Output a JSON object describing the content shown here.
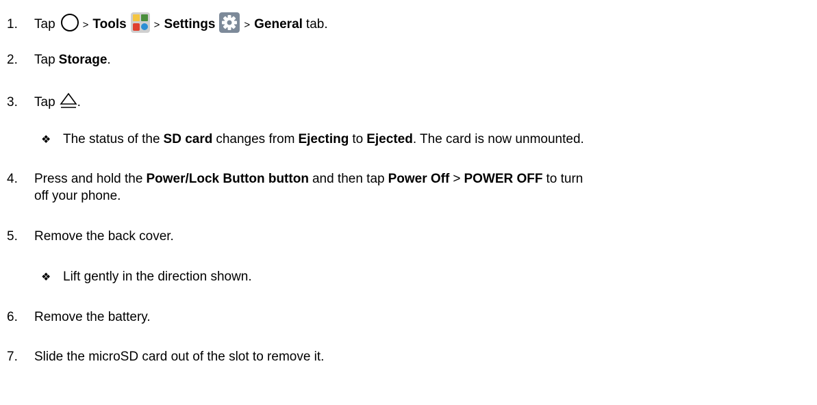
{
  "steps": {
    "s1": {
      "num": "1.",
      "t1": "Tap",
      "sep1": ">",
      "tools": "Tools",
      "sep2": ">",
      "settings": "Settings",
      "sep3": ">",
      "general": "General",
      "t2": "tab."
    },
    "s2": {
      "num": "2.",
      "t1": "Tap",
      "storage": "Storage",
      "t2": "."
    },
    "s3": {
      "num": "3.",
      "t1": "Tap",
      "t2": "."
    },
    "b1": {
      "bullet": "❖",
      "t1": "The status of the",
      "sd": "SD card",
      "t2": "changes from",
      "ejecting": "Ejecting",
      "t3": "to",
      "ejected": "Ejected",
      "t4": ". The card is now unmounted."
    },
    "s4": {
      "num": "4.",
      "t1": "Press and hold the",
      "power": "Power/Lock Button button",
      "t2": "and then tap",
      "poweroff": "Power Off",
      "sep": ">",
      "poweroff2": "POWER OFF",
      "t3": "to turn",
      "line2": "off your phone."
    },
    "s5": {
      "num": "5.",
      "text": "Remove the back cover."
    },
    "b2": {
      "bullet": "❖",
      "text": "Lift gently in the direction shown."
    },
    "s6": {
      "num": "6.",
      "text": "Remove the battery."
    },
    "s7": {
      "num": "7.",
      "text": "Slide the microSD card out of the slot to remove it."
    }
  },
  "icons": {
    "home": "home-circle-icon",
    "tools": "tools-folder-icon",
    "settings": "settings-gear-icon",
    "eject": "eject-icon"
  }
}
